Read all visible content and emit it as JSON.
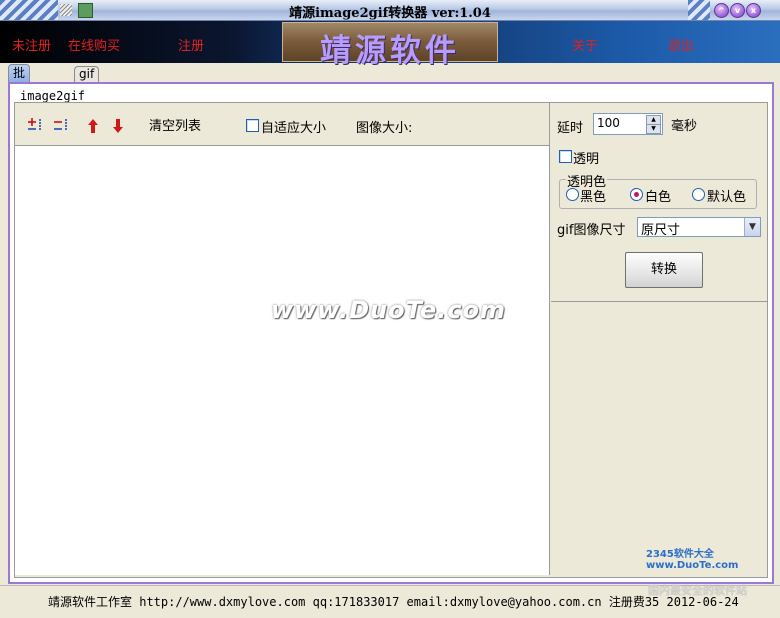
{
  "window": {
    "title": "靖源image2gif转换器 ver:1.04",
    "buttons": [
      "^",
      "v",
      "x"
    ]
  },
  "menu": {
    "items": [
      "未注册",
      "在线购买",
      "注册",
      "关于",
      "退出"
    ],
    "logo_text": "靖源软件"
  },
  "tabs": [
    "批量转换",
    "gif分解"
  ],
  "panel": {
    "group_title": "image2gif",
    "toolbar": {
      "clear_list": "清空列表",
      "auto_size": "自适应大小",
      "image_size": "图像大小:"
    },
    "watermark": "www.DuoTe.com"
  },
  "settings": {
    "delay_label": "延时",
    "delay_value": "100",
    "delay_unit": "毫秒",
    "transparent_label": "透明",
    "transparent_color_legend": "透明色",
    "colors": [
      "黑色",
      "白色",
      "默认色"
    ],
    "selected_color": "白色",
    "size_label": "gif图像尺寸",
    "size_value": "原尺寸",
    "convert_button": "转换"
  },
  "status": {
    "text": "靖源软件工作室 http://www.dxmylove.com qq:171833017 email:dxmylove@yahoo.com.cn 注册费35 2012-06-24"
  },
  "corner": {
    "badge": "2345软件大全 www.DuoTe.com",
    "badge2": "国内最安全的软件站"
  },
  "colors": {
    "menu_text": "#e32020",
    "panel_border": "#9a78d8",
    "tab_active": "#8fb0e6"
  }
}
